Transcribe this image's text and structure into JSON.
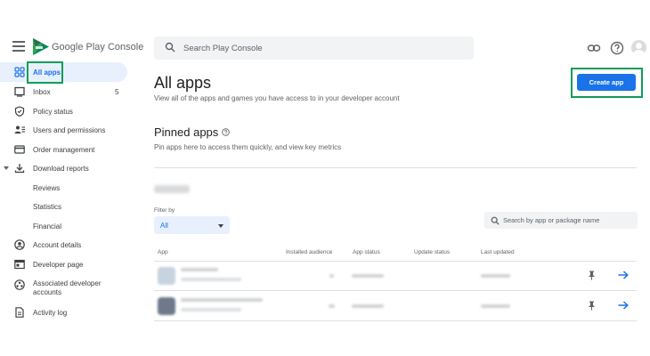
{
  "topbar": {
    "brand": "Google Play Console",
    "search_placeholder": "Search Play Console"
  },
  "sidebar": {
    "items": [
      {
        "label": "All apps",
        "icon": "grid-icon",
        "active": true
      },
      {
        "label": "Inbox",
        "icon": "inbox-icon",
        "count": "5"
      },
      {
        "label": "Policy status",
        "icon": "shield-icon"
      },
      {
        "label": "Users and permissions",
        "icon": "users-icon"
      },
      {
        "label": "Order management",
        "icon": "card-icon"
      },
      {
        "label": "Download reports",
        "icon": "download-icon"
      },
      {
        "label": "Reviews"
      },
      {
        "label": "Statistics"
      },
      {
        "label": "Financial"
      },
      {
        "label": "Account details",
        "icon": "account-icon"
      },
      {
        "label": "Developer page",
        "icon": "web-page-icon"
      },
      {
        "label": "Associated developer accounts",
        "icon": "associated-accounts-icon"
      },
      {
        "label": "Activity log",
        "icon": "log-icon"
      }
    ]
  },
  "main": {
    "title": "All apps",
    "subtitle": "View all of the apps and games you have access to in your developer account",
    "create_button": "Create app",
    "pinned": {
      "title": "Pinned apps",
      "subtitle": "Pin apps here to access them quickly, and view key metrics"
    },
    "filter": {
      "label": "Filter by",
      "value": "All"
    },
    "app_search_placeholder": "Search by app or package name",
    "table": {
      "headers": [
        "App",
        "Installed audience",
        "App status",
        "Update status",
        "Last updated"
      ]
    }
  },
  "colors": {
    "accent": "#1a73e8",
    "highlight": "#0f9d58"
  }
}
